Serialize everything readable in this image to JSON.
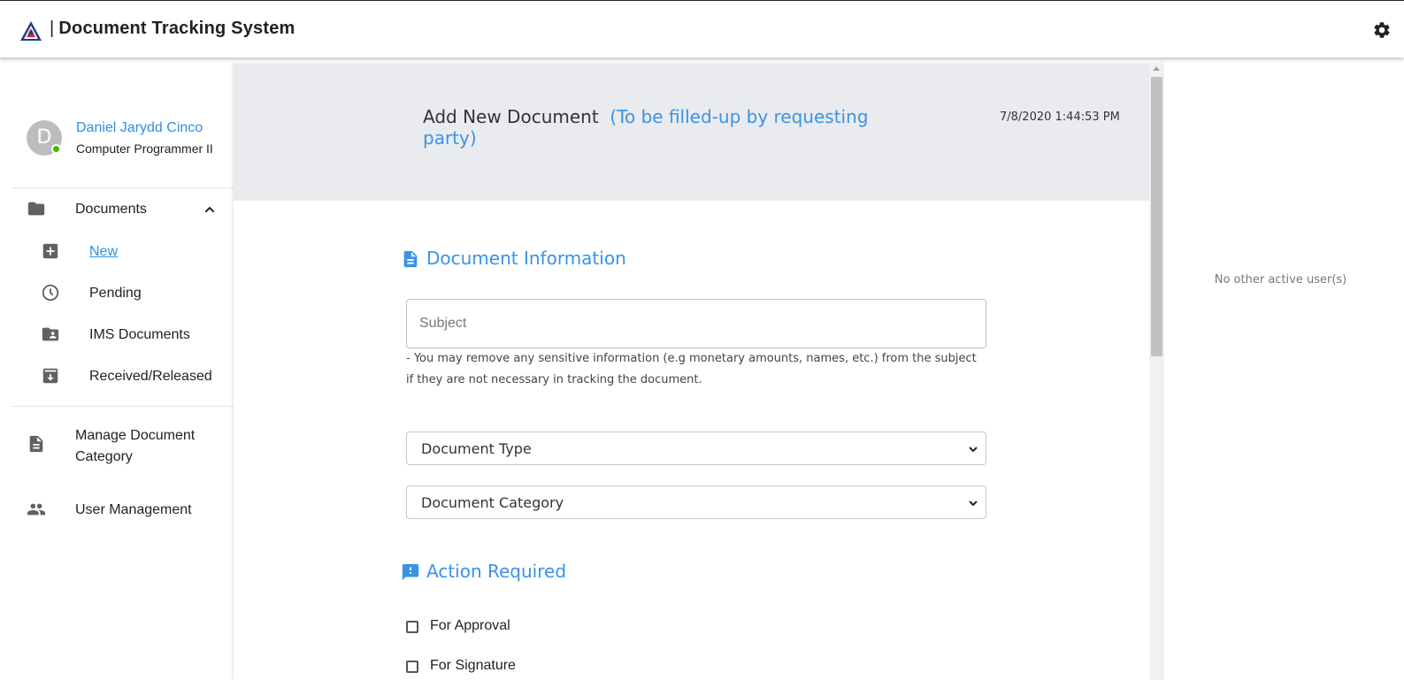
{
  "app": {
    "title": "Document Tracking System",
    "separator": "|"
  },
  "user": {
    "initial": "D",
    "name": "Daniel Jarydd Cinco",
    "role": "Computer Programmer II",
    "status": "online"
  },
  "sidebar": {
    "documents_label": "Documents",
    "sub_items": [
      {
        "label": "New",
        "icon": "add-box-icon",
        "active": true
      },
      {
        "label": "Pending",
        "icon": "clock-icon",
        "active": false
      },
      {
        "label": "IMS Documents",
        "icon": "folder-shared-icon",
        "active": false
      },
      {
        "label": "Received/Released",
        "icon": "archive-icon",
        "active": false
      }
    ],
    "manage_label": "Manage Document Category",
    "user_mgmt_label": "User Management"
  },
  "header": {
    "title": "Add New Document",
    "subtitle": "(To be filled-up by requesting party)",
    "timestamp": "7/8/2020 1:44:53 PM"
  },
  "form": {
    "doc_info_title": "Document Information",
    "subject_placeholder": "Subject",
    "subject_hint": "- You may remove any sensitive information (e.g monetary amounts, names, etc.) from the subject if they are not necessary in tracking the document.",
    "doc_type_selected": "Document Type",
    "doc_category_selected": "Document Category",
    "action_title": "Action Required",
    "actions": [
      {
        "label": "For Approval",
        "checked": false
      },
      {
        "label": "For Signature",
        "checked": false
      }
    ]
  },
  "right_panel": {
    "message": "No other active user(s)"
  },
  "colors": {
    "accent": "#3a93e6",
    "online": "#44b700",
    "header_band": "#e9ebee"
  }
}
